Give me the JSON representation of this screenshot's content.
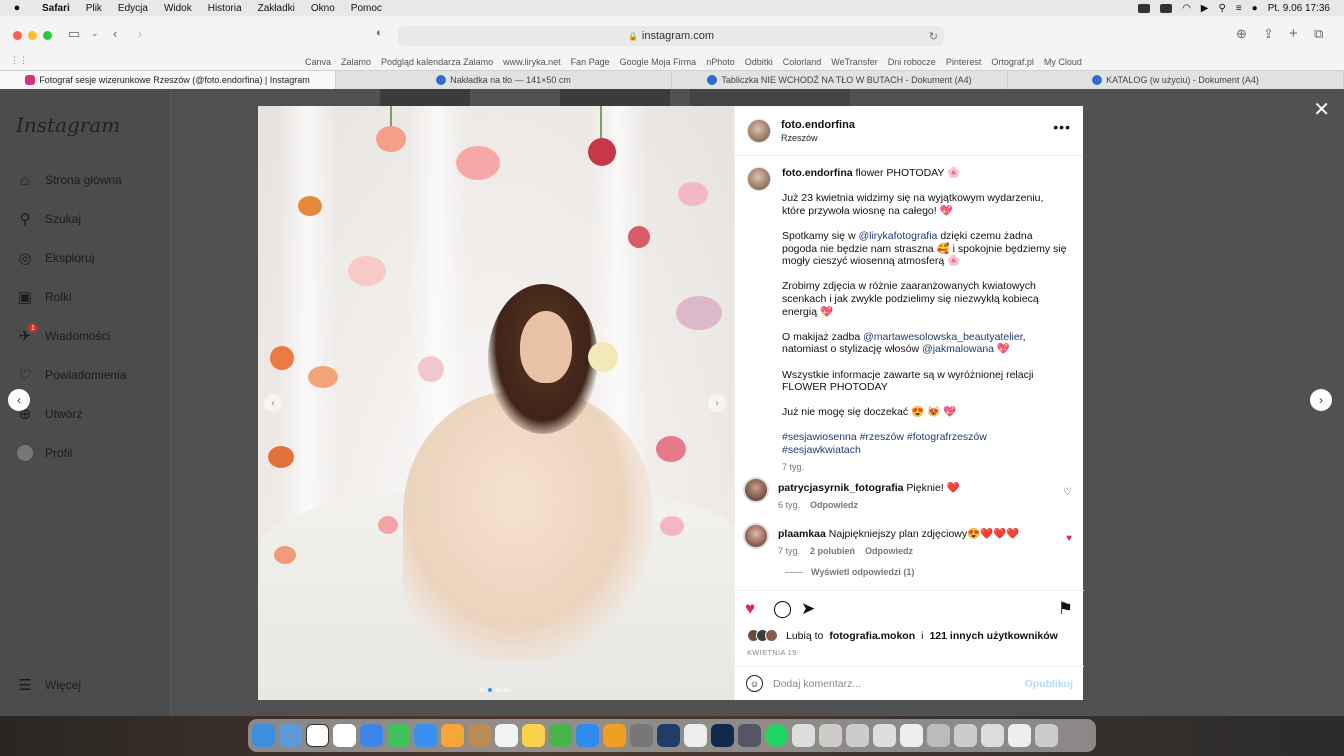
{
  "menubar": {
    "app": "Safari",
    "items": [
      "Plik",
      "Edycja",
      "Widok",
      "Historia",
      "Zakładki",
      "Okno",
      "Pomoc"
    ],
    "clock": "Pt. 9.06  17:36"
  },
  "browser": {
    "url": "instagram.com",
    "favorites": [
      "Canva",
      "Zalamo",
      "Podgląd kalendarza Zalamo",
      "www.liryka.net",
      "Fan Page",
      "Google Moja Firma",
      "nPhoto",
      "Odbitki",
      "Colorland",
      "WeTransfer",
      "Dni robocze",
      "Pinterest",
      "Ortograf.pl",
      "My Cloud"
    ],
    "tabs": [
      {
        "title": "Fotograf sesje wizerunkowe Rzeszów (@foto.endorfina) | Instagram",
        "color": "#d6307d"
      },
      {
        "title": "Nakładka na tło — 141×50 cm",
        "color": "#2a6fd0"
      },
      {
        "title": "Tabliczka NIE WCHODŹ NA TŁO W BUTACH - Dokument (A4)",
        "color": "#2a6fd0"
      },
      {
        "title": "KATALOG (w użyciu) - Dokument (A4)",
        "color": "#2a6fd0"
      }
    ]
  },
  "instagram": {
    "logo": "Instagram",
    "nav": [
      {
        "label": "Strona główna",
        "icon": "home-icon",
        "glyph": "⌂"
      },
      {
        "label": "Szukaj",
        "icon": "search-icon",
        "glyph": "⚲"
      },
      {
        "label": "Eksploruj",
        "icon": "compass-icon",
        "glyph": "◎"
      },
      {
        "label": "Rolki",
        "icon": "reels-icon",
        "glyph": "▣"
      },
      {
        "label": "Wiadomości",
        "icon": "messenger-icon",
        "glyph": "✈",
        "badge": "1"
      },
      {
        "label": "Powiadomienia",
        "icon": "heart-icon",
        "glyph": "♡"
      },
      {
        "label": "Utwórz",
        "icon": "create-icon",
        "glyph": "⊕"
      },
      {
        "label": "Profil",
        "icon": "profile-avatar",
        "glyph": ""
      }
    ],
    "more": "Więcej",
    "post": {
      "username": "foto.endorfina",
      "location": "Rzeszów",
      "caption_first": "flower PHOTODAY 🌸",
      "caption": [
        {
          "text": "Już 23 kwietnia widzimy się na wyjątkowym wydarzeniu, które przywoła wiosnę na całego! 💖"
        },
        {
          "pre": "Spotkamy się w ",
          "link": "@lirykafotografia",
          "post": " dzięki czemu żadna pogoda nie będzie nam straszna 🥰 i spokojnie będziemy się mogły cieszyć wiosenną atmosferą 🌸"
        },
        {
          "text": "Zrobimy zdjęcia w różnie zaaranżowanych kwiatowych scenkach i jak zwykle podzielimy się niezwykłą kobiecą energią 💖"
        },
        {
          "pre": "O makijaż zadba ",
          "link": "@martawesolowska_beautyatelier",
          "mid": ", natomiast o stylizację włosów ",
          "link2": "@jakmalowana",
          "post": " 💖"
        },
        {
          "text": "Wszystkie informacje zawarte są w wyróżnionej relacji FLOWER PHOTODAY"
        },
        {
          "text": "Już nie mogę się doczekać 😍 😻 💖"
        }
      ],
      "hashtags": "#sesjawiosenna #rzeszów #fotografrzeszów #sesjawkwiatach",
      "caption_age": "7 tyg.",
      "comments": [
        {
          "user": "patrycjasyrnik_fotografia",
          "text": "Pięknie! ❤️",
          "age": "6 tyg.",
          "likes": "",
          "reply": "Odpowiedz",
          "liked": false
        },
        {
          "user": "plaamkaa",
          "text": "Najpiękniejszy plan zdjęciowy😍❤️❤️❤️",
          "age": "7 tyg.",
          "likes": "2 polubień",
          "reply": "Odpowiedz",
          "liked": true
        }
      ],
      "view_replies": "Wyświetl odpowiedzi (1)",
      "liked_by_prefix": "Lubią to ",
      "liked_by_user": "fotografia.mokon",
      "liked_by_mid": " i ",
      "liked_by_rest": "121 innych użytkowników",
      "date": "KWIETNIA 19",
      "comment_placeholder": "Dodaj komentarz...",
      "post_button": "Opublikuj",
      "carousel": {
        "count": 4,
        "active": 1
      }
    }
  }
}
